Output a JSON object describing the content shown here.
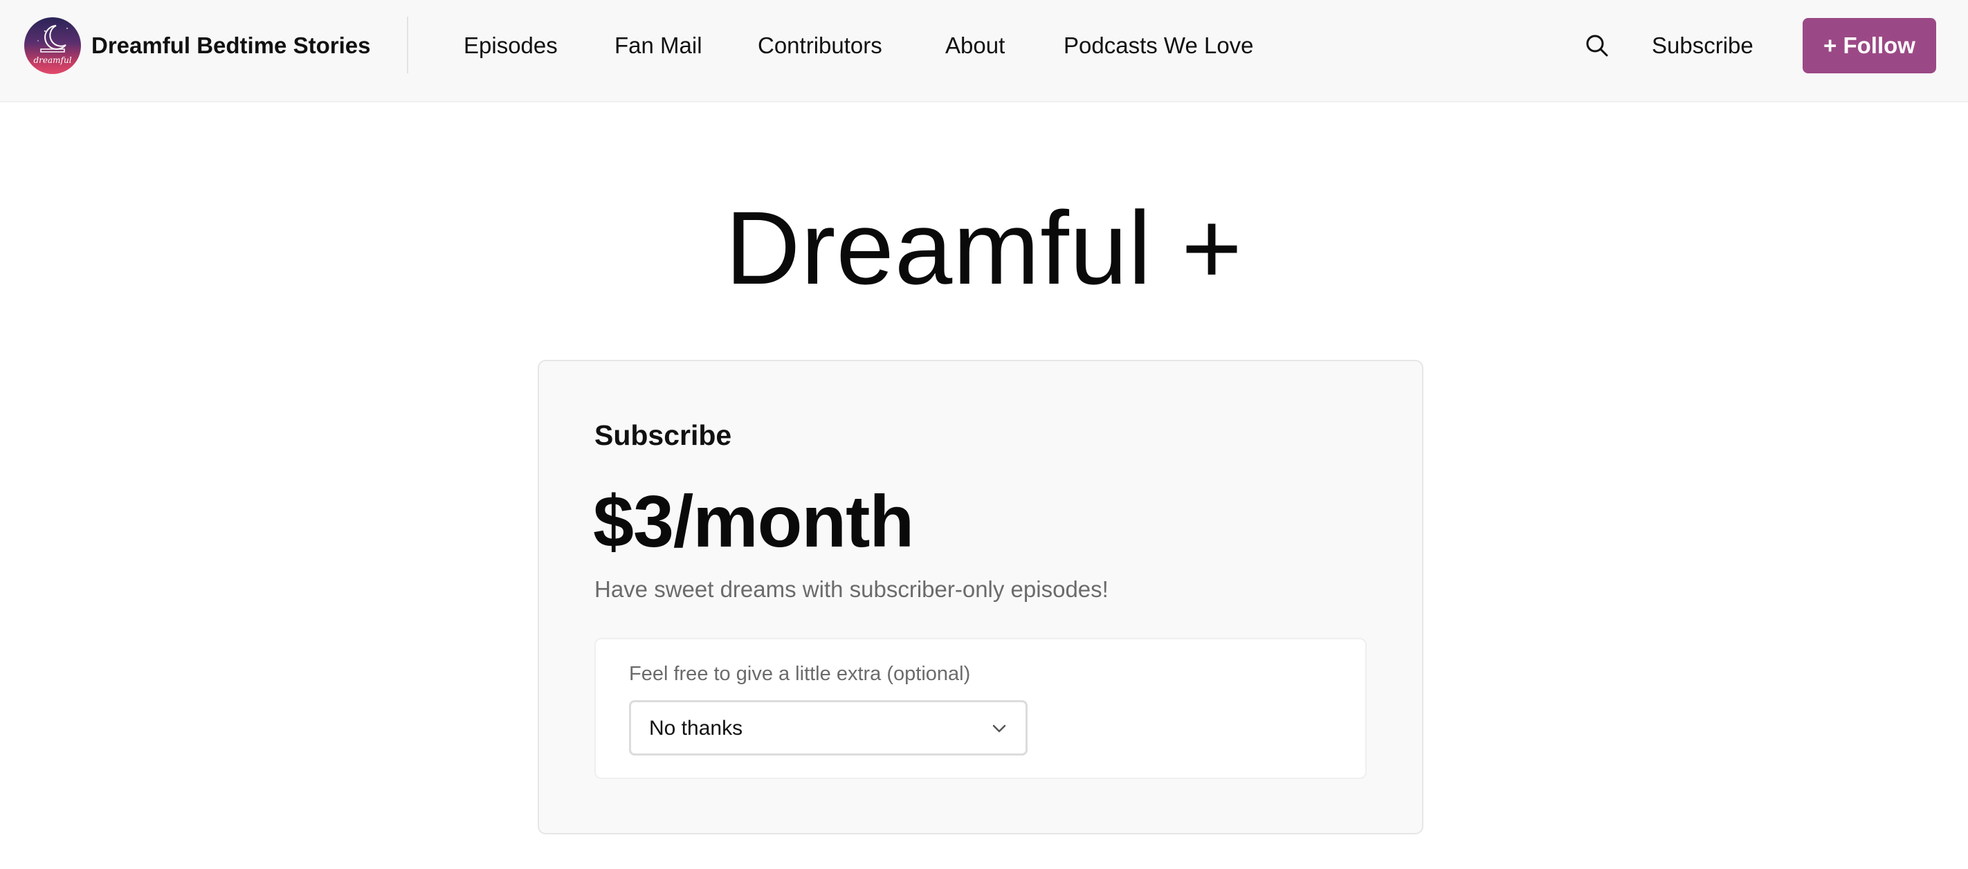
{
  "header": {
    "brand_name": "Dreamful Bedtime Stories",
    "logo_text": "dreamful",
    "nav": [
      {
        "label": "Episodes"
      },
      {
        "label": "Fan Mail"
      },
      {
        "label": "Contributors"
      },
      {
        "label": "About"
      },
      {
        "label": "Podcasts We Love"
      }
    ],
    "search_icon": "search-icon",
    "subscribe_label": "Subscribe",
    "follow_label": "+ Follow",
    "follow_color": "#9b4986"
  },
  "main": {
    "title": "Dreamful +",
    "card": {
      "heading": "Subscribe",
      "price": "$3/month",
      "description": "Have sweet dreams with subscriber-only episodes!",
      "extra_label": "Feel free to give a little extra (optional)",
      "extra_select_value": "No thanks",
      "select_icon": "chevron-down-icon"
    }
  }
}
